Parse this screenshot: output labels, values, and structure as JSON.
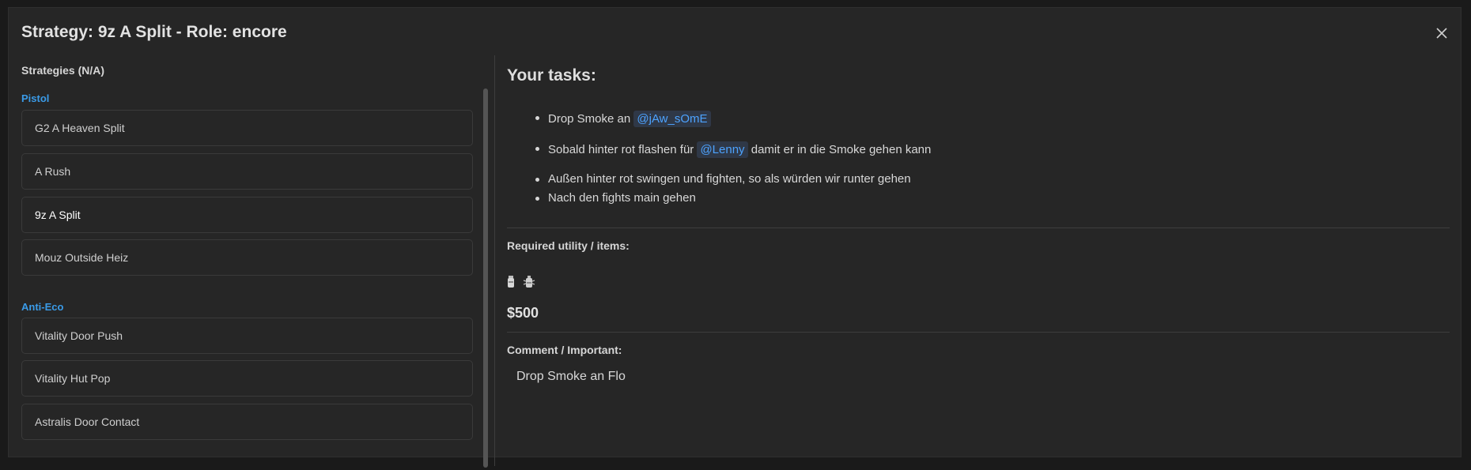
{
  "modal": {
    "title": "Strategy: 9z A Split - Role: encore",
    "close_icon": "close-icon"
  },
  "sidebar": {
    "heading": "Strategies (N/A)",
    "groups": [
      {
        "label": "Pistol",
        "items": [
          {
            "label": "G2 A Heaven Split",
            "active": false
          },
          {
            "label": "A Rush",
            "active": false
          },
          {
            "label": "9z A Split",
            "active": true
          },
          {
            "label": "Mouz Outside Heiz",
            "active": false
          }
        ]
      },
      {
        "label": "Anti-Eco",
        "items": [
          {
            "label": "Vitality Door Push",
            "active": false
          },
          {
            "label": "Vitality Hut Pop",
            "active": false
          },
          {
            "label": "Astralis Door Contact",
            "active": false
          }
        ]
      }
    ]
  },
  "main": {
    "tasks_title": "Your tasks:",
    "tasks": [
      {
        "before": "Drop Smoke an",
        "mention": "@jAw_sOmE",
        "after": ""
      },
      {
        "before": "Sobald hinter rot flashen für",
        "mention": "@Lenny",
        "after": "damit er in die Smoke gehen kann"
      },
      {
        "before": "Außen hinter rot swingen und fighten, so als würden wir runter gehen",
        "mention": "",
        "after": ""
      },
      {
        "before": "Nach den fights main gehen",
        "mention": "",
        "after": ""
      }
    ],
    "required_label": "Required utility / items:",
    "utility_icons": [
      "smoke-grenade-icon",
      "flashbang-icon"
    ],
    "price": "$500",
    "comment_label": "Comment / Important:",
    "comment_text": "Drop Smoke an Flo"
  },
  "colors": {
    "accent": "#3a9be8",
    "mention_text": "#4da3ff",
    "mention_bg": "#2f3847",
    "background": "#262626"
  }
}
